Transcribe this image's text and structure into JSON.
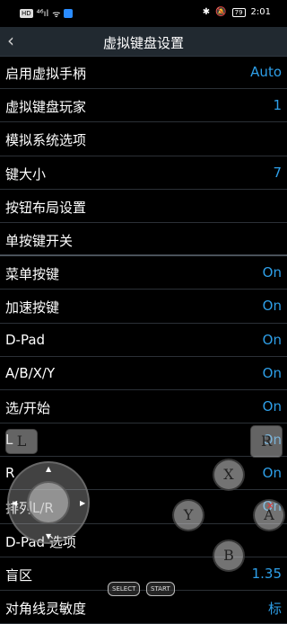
{
  "status_bar": {
    "left_chip": "HD",
    "signal": "⁴⁶ıl",
    "wifi": "ᯤ",
    "time": "2:01",
    "battery": "79",
    "icons": [
      "bluetooth-icon",
      "mute-icon",
      "notify-icon"
    ]
  },
  "header": {
    "title": "虚拟键盘设置",
    "back": "‹"
  },
  "settings": [
    {
      "label": "启用虚拟手柄",
      "value": "Auto"
    },
    {
      "label": "虚拟键盘玩家",
      "value": "1"
    },
    {
      "label": "模拟系统选项",
      "value": ""
    },
    {
      "label": "键大小",
      "value": "7"
    },
    {
      "label": "按钮布局设置",
      "value": ""
    },
    {
      "label": "单按键开关",
      "value": ""
    },
    {
      "label": "菜单按键",
      "value": "On"
    },
    {
      "label": "加速按键",
      "value": "On"
    },
    {
      "label": "D-Pad",
      "value": "On"
    },
    {
      "label": "A/B/X/Y",
      "value": "On"
    },
    {
      "label": "选/开始",
      "value": "On"
    },
    {
      "label": "L",
      "value": "On"
    },
    {
      "label": "R",
      "value": "On"
    },
    {
      "label": "排列L/R",
      "value": "On"
    },
    {
      "label": "D-Pad 选项",
      "value": ""
    },
    {
      "label": "盲区",
      "value": "1.35"
    },
    {
      "label": "对角线灵敏度",
      "value": "标"
    }
  ],
  "overlay": {
    "l_button": "L",
    "r_button": "R",
    "x_button": "X",
    "y_button": "Y",
    "a_button": "A",
    "b_button": "B",
    "select_button": "SELECT",
    "start_button": "START"
  }
}
